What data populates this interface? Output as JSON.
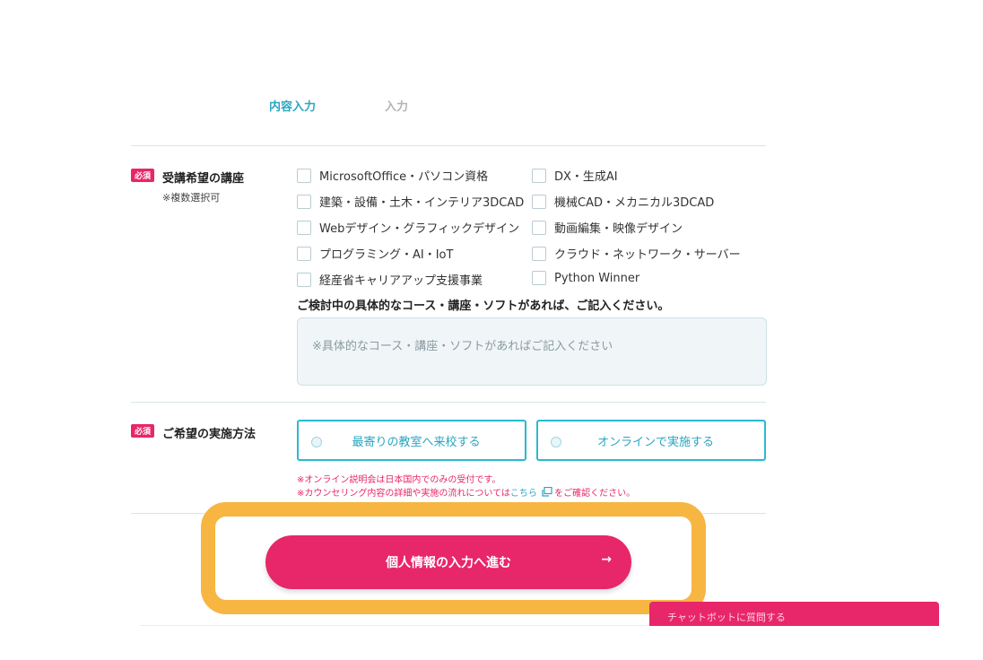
{
  "steps": [
    {
      "label": "内容入力",
      "active": true
    },
    {
      "label": "入力",
      "active": false
    }
  ],
  "colors": {
    "accent": "#e8266a",
    "teal": "#2aa6c0",
    "highlight": "#f7b541"
  },
  "courses": {
    "badge": "必須",
    "title": "受講希望の講座",
    "note": "※複数選択可",
    "options_left": [
      "MicrosoftOffice・パソコン資格",
      "建築・設備・土木・インテリア3DCAD",
      "Webデザイン・グラフィックデザイン",
      "プログラミング・AI・IoT",
      "経産省キャリアアップ支援事業"
    ],
    "options_right": [
      "DX・生成AI",
      "機械CAD・メカニカル3DCAD",
      "動画編集・映像デザイン",
      "クラウド・ネットワーク・サーバー",
      "Python Winner"
    ],
    "detail_question": "ご検討中の具体的なコース・講座・ソフトがあれば、ご記入ください。",
    "detail_placeholder": "※具体的なコース・講座・ソフトがあればご記入ください"
  },
  "method": {
    "badge": "必須",
    "title": "ご希望の実施方法",
    "option_classroom": "最寄りの教室へ来校する",
    "option_online": "オンラインで実施する",
    "note1": "※オンライン説明会は日本国内でのみの受付です。",
    "note2_before": "※カウンセリング内容の詳細や実施の流れについては",
    "note2_link": "こちら",
    "note2_after": "をご確認ください。"
  },
  "submit": {
    "label": "個人情報の入力へ進む",
    "arrow": "→"
  },
  "chatbot": {
    "label": "チャットボットに質問する"
  }
}
